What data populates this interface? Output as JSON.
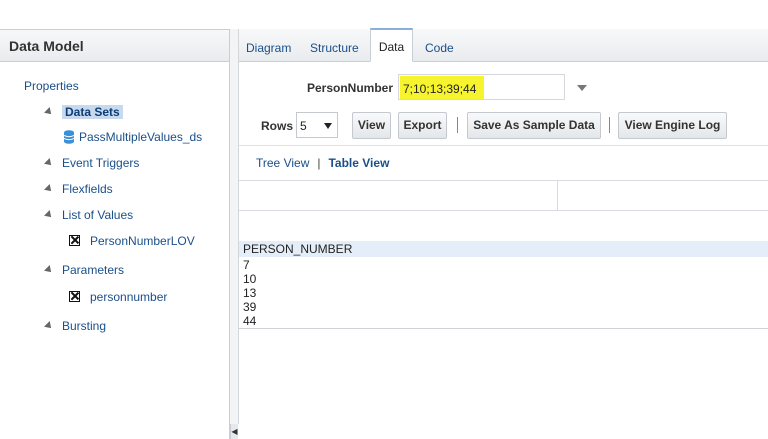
{
  "left_panel": {
    "title": "Data Model",
    "tree": {
      "properties": "Properties",
      "data_sets": "Data Sets",
      "data_set_item": "PassMultipleValues_ds",
      "event_triggers": "Event Triggers",
      "flexfields": "Flexfields",
      "list_of_values": "List of Values",
      "lov_item": "PersonNumberLOV",
      "parameters": "Parameters",
      "parameter_item": "personnumber",
      "bursting": "Bursting"
    }
  },
  "tabs": [
    {
      "label": "Diagram"
    },
    {
      "label": "Structure"
    },
    {
      "label": "Data"
    },
    {
      "label": "Code"
    }
  ],
  "parameter": {
    "label": "PersonNumber",
    "value": "7;10;13;39;44"
  },
  "toolbar": {
    "rows_label": "Rows",
    "rows_value": "5",
    "view_label": "View",
    "export_label": "Export",
    "save_sample_label": "Save As Sample Data",
    "view_engine_log_label": "View Engine Log"
  },
  "view_switch": {
    "tree_view": "Tree View",
    "separator": "|",
    "table_view": "Table View"
  },
  "table": {
    "header": "PERSON_NUMBER",
    "rows": [
      "7",
      "10",
      "13",
      "39",
      "44"
    ]
  },
  "colors": {
    "highlight": "#f7f42d",
    "link": "#1a4f8a",
    "selected_bg": "#c8d9ee"
  }
}
